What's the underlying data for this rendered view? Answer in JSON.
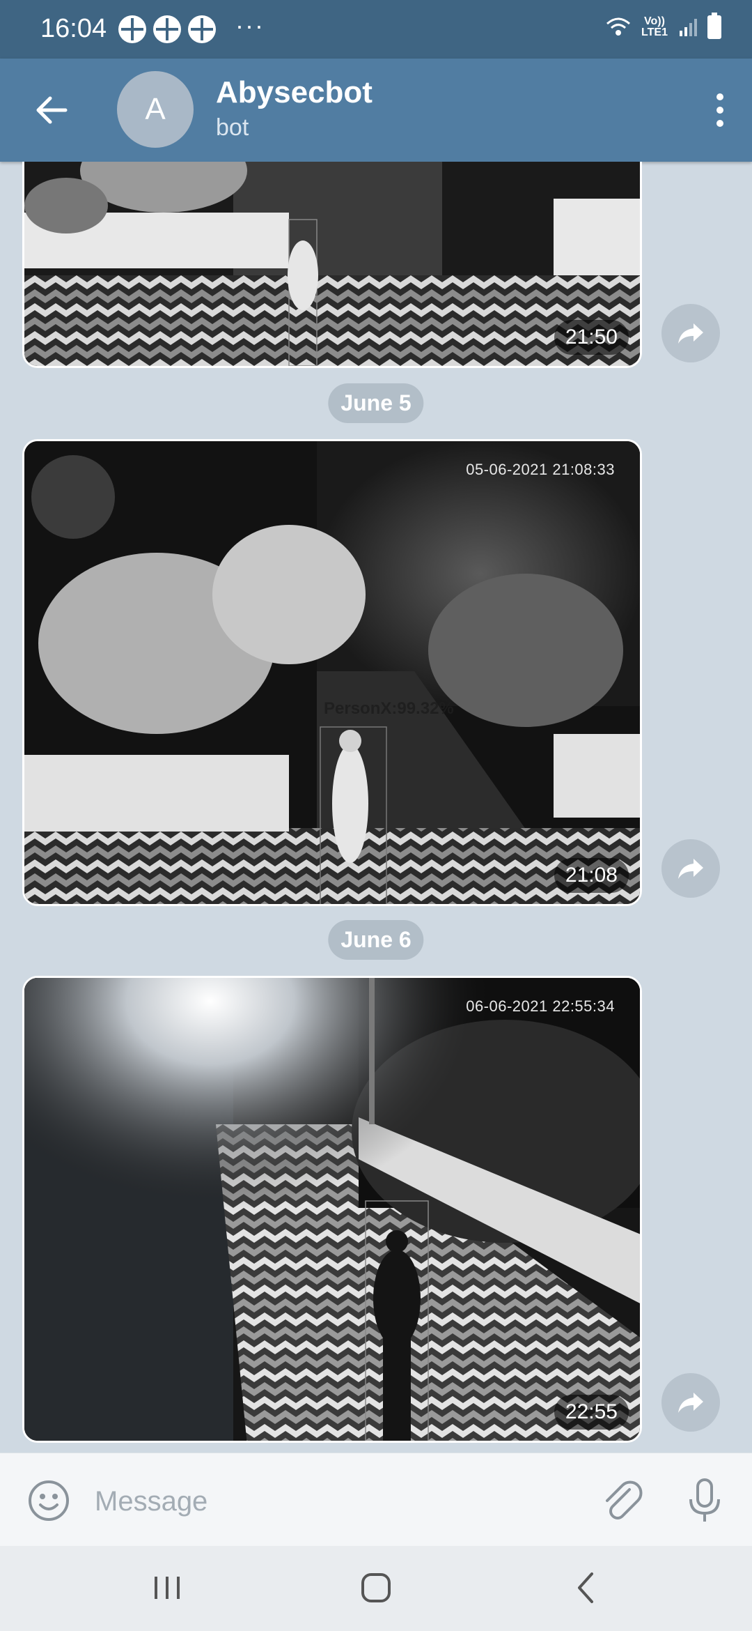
{
  "status_bar": {
    "time": "16:04",
    "more": "···",
    "lte": "Vo)) LTE1"
  },
  "header": {
    "avatar_letter": "A",
    "title": "Abysecbot",
    "subtitle": "bot"
  },
  "messages": [
    {
      "time": "21:50",
      "stamp": "",
      "label": ""
    },
    {
      "date": "June 5",
      "time": "21:08",
      "stamp": "05-06-2021 21:08:33",
      "label": "PersonX:99.32%"
    },
    {
      "date": "June 6",
      "time": "22:55",
      "stamp": "06-06-2021 22:55:34",
      "label": ""
    }
  ],
  "composer": {
    "placeholder": "Message"
  },
  "colors": {
    "header": "#517da2",
    "status": "#3f6583",
    "chat_bg": "#cfd9e2"
  }
}
